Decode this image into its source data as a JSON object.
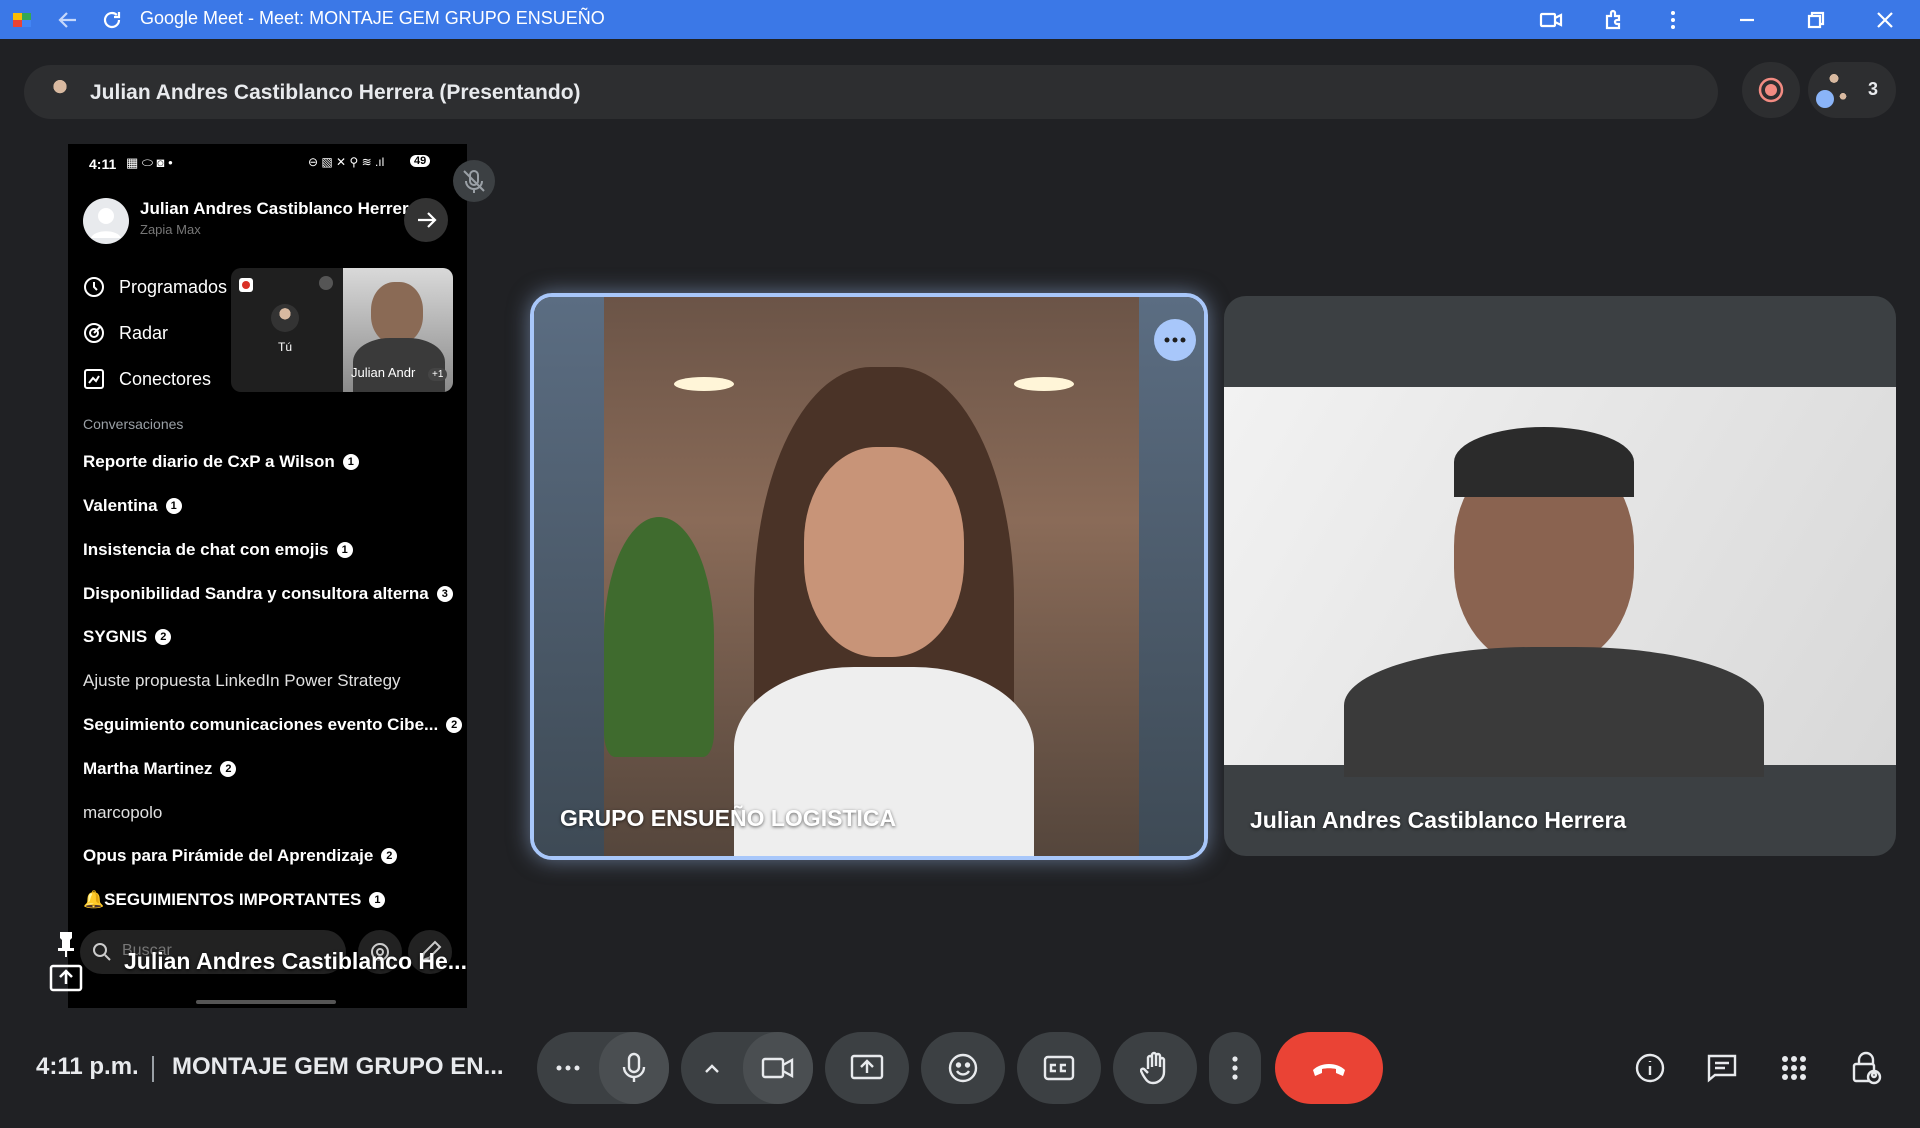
{
  "browser": {
    "title": "Google Meet - Meet: MONTAJE GEM GRUPO ENSUEÑO"
  },
  "presenter_bar": {
    "label": "Julian Andres Castiblanco Herrera (Presentando)",
    "participants_count": "3"
  },
  "phone": {
    "status_time": "4:11",
    "battery": "49",
    "account_name": "Julian Andres Castiblanco Herrera",
    "account_org": "Zapia Max",
    "menu": [
      "Programados",
      "Radar",
      "Conectores"
    ],
    "pip_you_label": "Tú",
    "pip_other_label": "Julian Andr",
    "pip_plus": "+1",
    "section_label": "Conversaciones",
    "conversations": [
      {
        "title": "Reporte diario de CxP a Wilson",
        "badge": "1"
      },
      {
        "title": "Valentina",
        "badge": "1"
      },
      {
        "title": "Insistencia de chat con emojis",
        "badge": "1"
      },
      {
        "title": "Disponibilidad Sandra y consultora alterna",
        "badge": "3"
      },
      {
        "title": "SYGNIS",
        "badge": "2"
      },
      {
        "title": "Ajuste propuesta LinkedIn Power Strategy",
        "badge": ""
      },
      {
        "title": "Seguimiento comunicaciones evento Cibe...",
        "badge": "2"
      },
      {
        "title": "Martha Martinez",
        "badge": "2"
      },
      {
        "title": "marcopolo",
        "badge": ""
      },
      {
        "title": "Opus para Pirámide del Aprendizaje",
        "badge": "2"
      },
      {
        "title": "🔔SEGUIMIENTOS IMPORTANTES",
        "badge": "1"
      }
    ],
    "search_placeholder": "Buscar",
    "overlay_name": "Julian Andres Castiblanco He..."
  },
  "tiles": [
    {
      "name": "GRUPO ENSUEÑO LOGISTICA"
    },
    {
      "name": "Julian Andres Castiblanco Herrera"
    }
  ],
  "bottom": {
    "time": "4:11 p.m.",
    "meeting": "MONTAJE GEM GRUPO EN..."
  },
  "colors": {
    "titlebar": "#3b78e7",
    "end_call": "#ea4335",
    "highlight": "#a8c7fa"
  }
}
